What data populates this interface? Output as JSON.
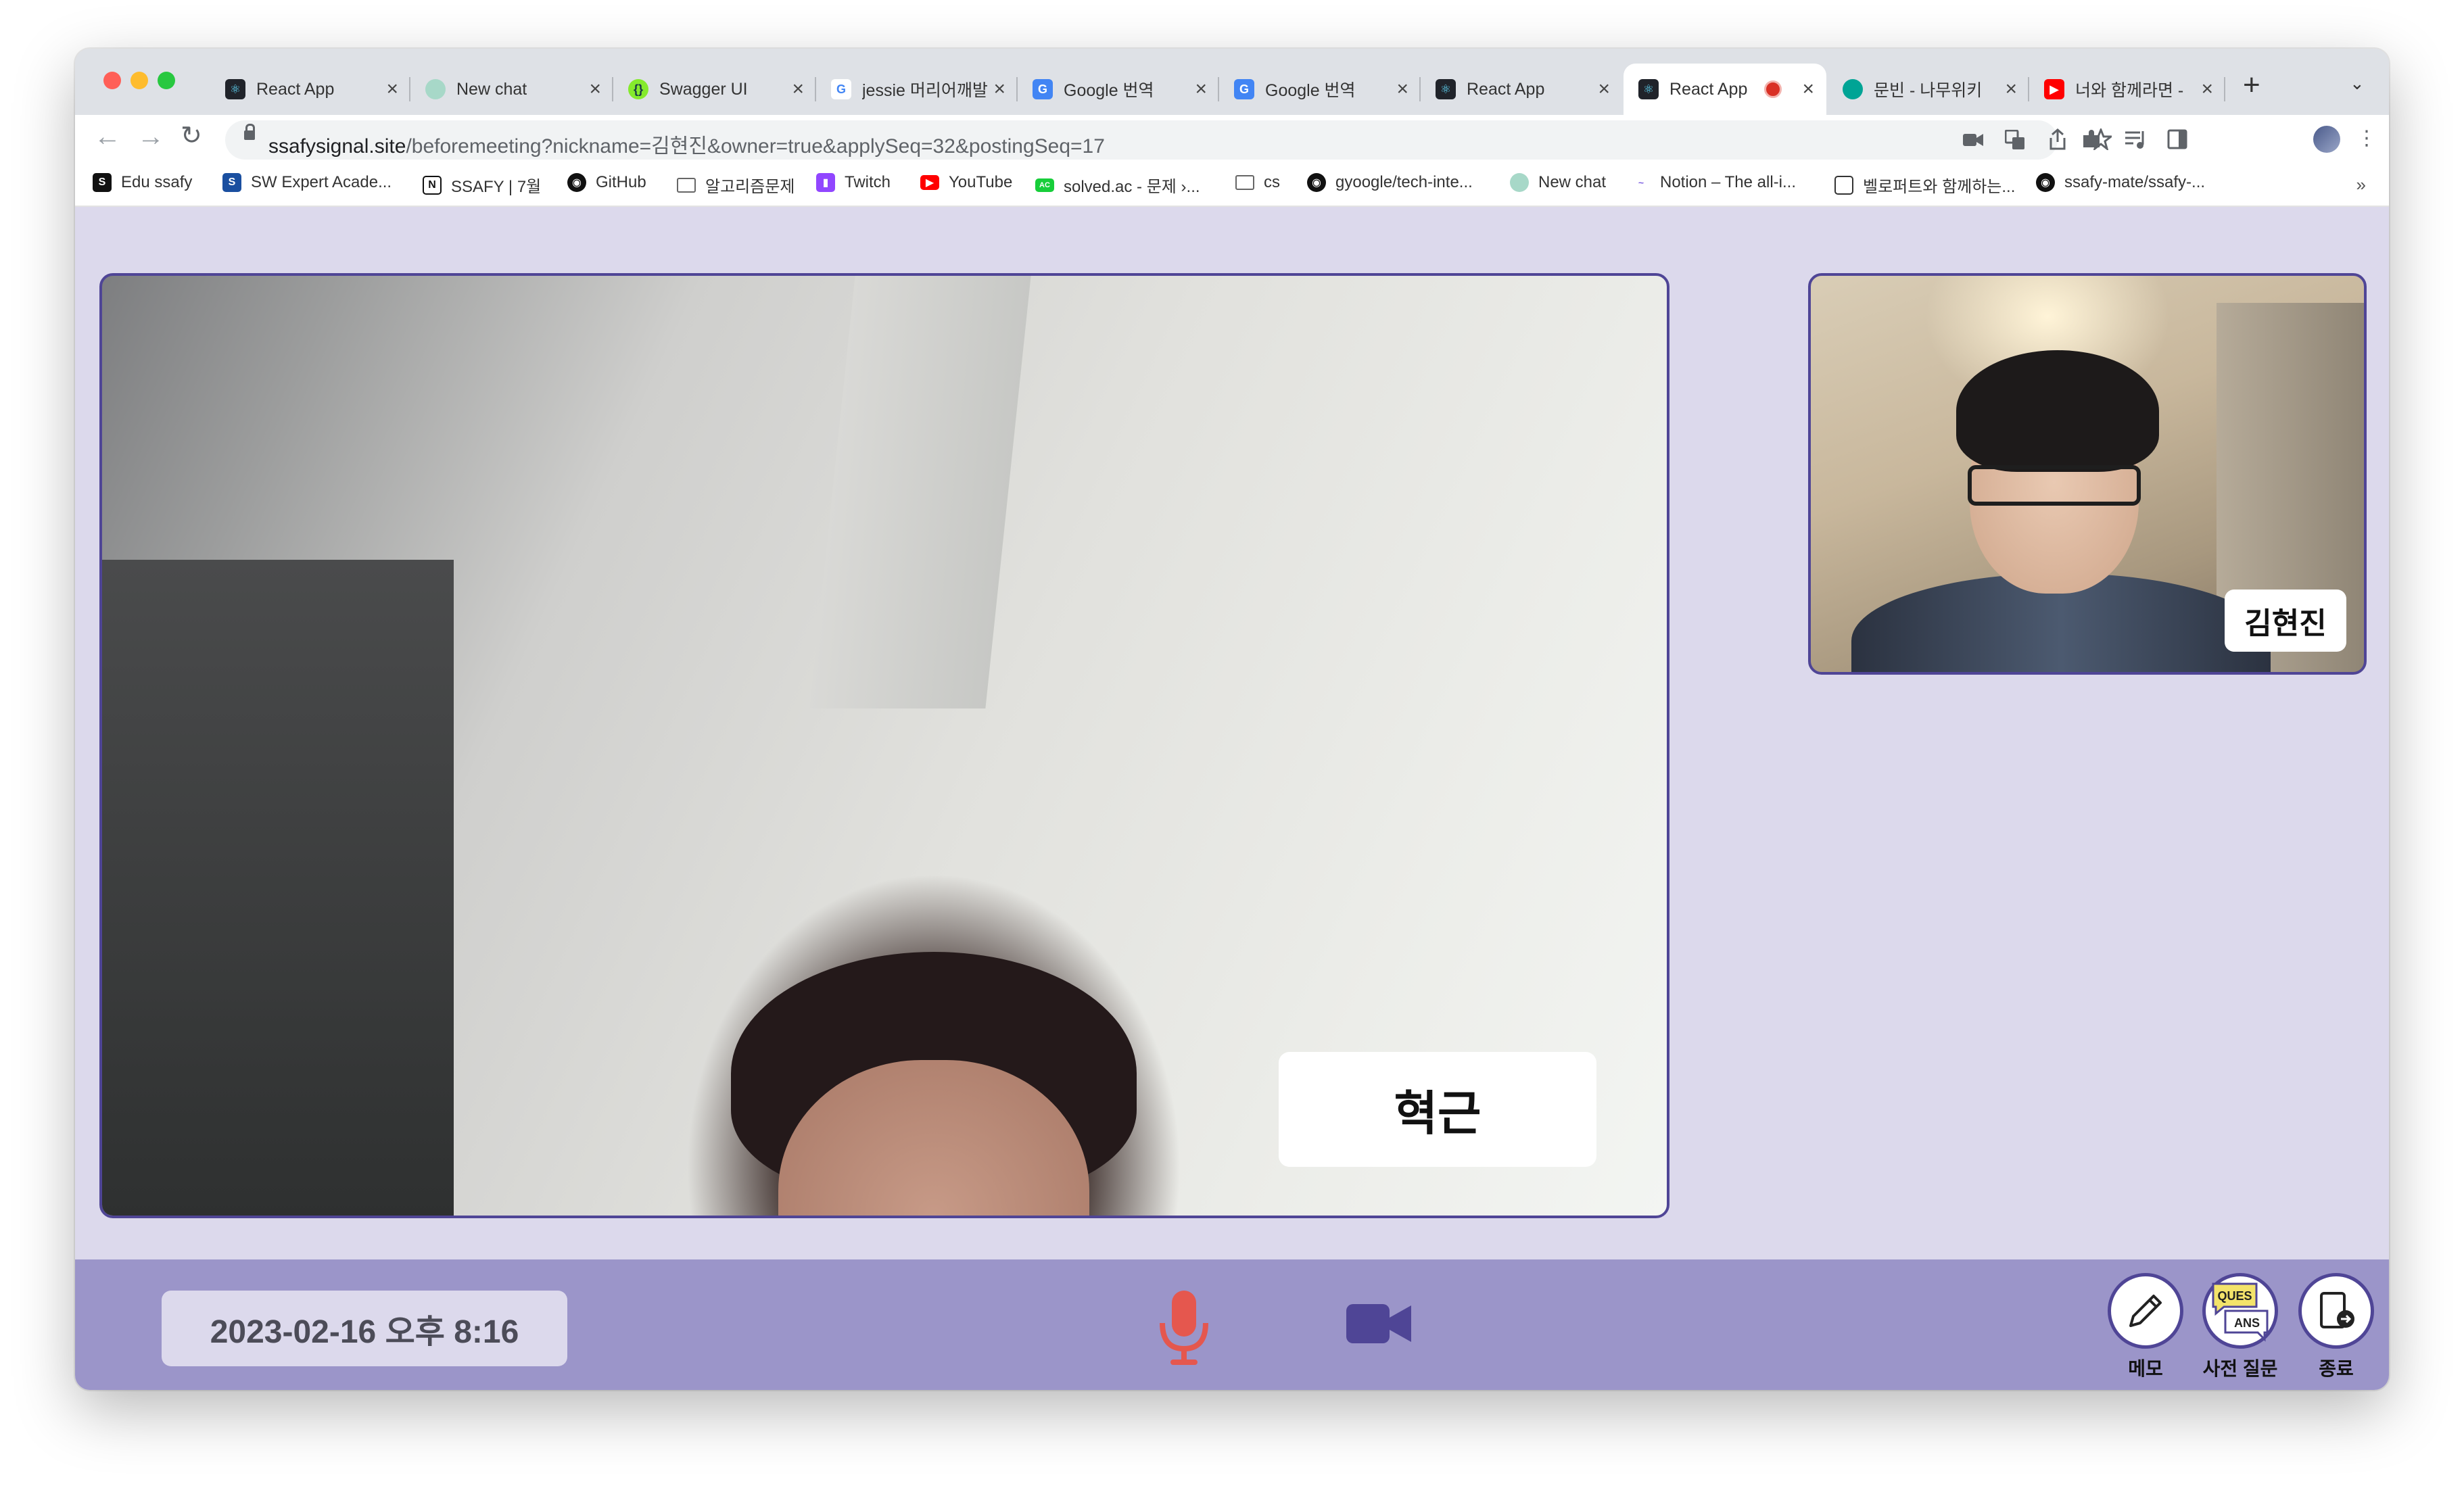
{
  "browser": {
    "tabs": [
      {
        "title": "React App",
        "icon": "react-icon",
        "active": false
      },
      {
        "title": "New chat",
        "icon": "chatgpt-icon",
        "active": false
      },
      {
        "title": "Swagger UI",
        "icon": "swagger-icon",
        "active": false
      },
      {
        "title": "jessie 머리어깨발",
        "icon": "google-icon",
        "active": false
      },
      {
        "title": "Google 번역",
        "icon": "translate-icon",
        "active": false
      },
      {
        "title": "Google 번역",
        "icon": "translate-icon",
        "active": false
      },
      {
        "title": "React App",
        "icon": "react-icon",
        "active": false
      },
      {
        "title": "React App",
        "icon": "react-icon",
        "active": true,
        "recording": true
      },
      {
        "title": "문빈 - 나무위키",
        "icon": "namuwiki-icon",
        "active": false
      },
      {
        "title": "너와 함께라면 -",
        "icon": "youtube-icon",
        "active": false
      }
    ],
    "url_host": "ssafysignal.site",
    "url_path": "/beforemeeting?nickname=김현진&owner=true&applySeq=32&postingSeq=17",
    "bookmarks": [
      {
        "label": "Edu ssafy",
        "icon": "edu-ssafy-icon"
      },
      {
        "label": "SW Expert Acade...",
        "icon": "swea-icon"
      },
      {
        "label": "SSAFY | 7월",
        "icon": "notion-icon"
      },
      {
        "label": "GitHub",
        "icon": "github-icon"
      },
      {
        "label": "알고리즘문제",
        "icon": "folder-icon"
      },
      {
        "label": "Twitch",
        "icon": "twitch-icon"
      },
      {
        "label": "YouTube",
        "icon": "youtube-icon"
      },
      {
        "label": "solved.ac - 문제 ›...",
        "icon": "solvedac-icon"
      },
      {
        "label": "cs",
        "icon": "folder-icon"
      },
      {
        "label": "gyoogle/tech-inte...",
        "icon": "github-icon"
      },
      {
        "label": "New chat",
        "icon": "chatgpt-icon"
      },
      {
        "label": "Notion – The all-i...",
        "icon": "notion-link-icon"
      },
      {
        "label": "벨로퍼트와 함께하는...",
        "icon": "book-icon"
      },
      {
        "label": "ssafy-mate/ssafy-...",
        "icon": "github-icon"
      }
    ],
    "more_bookmarks": "»"
  },
  "meeting": {
    "main_participant": "혁근",
    "self_participant": "김현진",
    "datetime": "2023-02-16 오후 8:16",
    "controls": [
      {
        "label": "메모",
        "icon": "pencil-icon"
      },
      {
        "label": "사전 질문",
        "icon": "question-answer-icon",
        "badge_top": "QUES",
        "badge_bottom": "ANS"
      },
      {
        "label": "종료",
        "icon": "exit-icon"
      }
    ]
  },
  "colors": {
    "page_bg": "#dcd9ec",
    "bottom_bar": "#9b95c9",
    "accent": "#4f4596",
    "mic": "#e5574e"
  }
}
